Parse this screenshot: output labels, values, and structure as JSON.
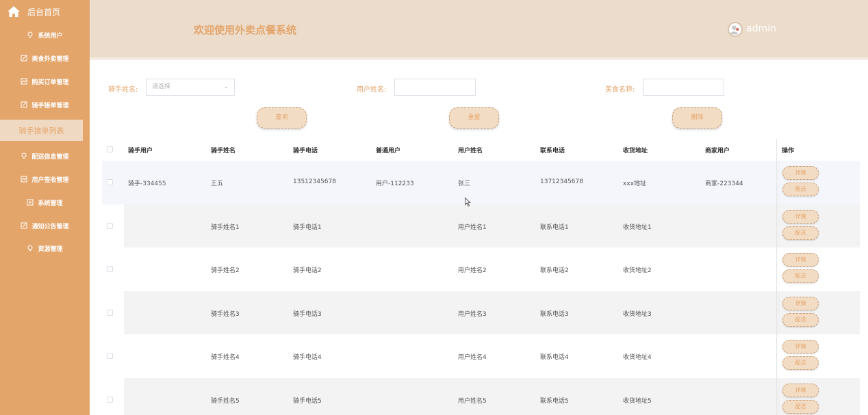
{
  "sidebar": {
    "home_label": "后台首页",
    "items": [
      {
        "label": "系统用户",
        "icon": "bulb-icon"
      },
      {
        "label": "美食外卖管理",
        "icon": "edit-icon"
      },
      {
        "label": "购买订单管理",
        "icon": "chart-icon"
      },
      {
        "label": "骑手接单管理",
        "icon": "edit-icon"
      },
      {
        "label": "骑手接单列表",
        "icon": "",
        "active": true
      },
      {
        "label": "配送信息管理",
        "icon": "bulb-icon"
      },
      {
        "label": "用户签收管理",
        "icon": "chart-icon"
      },
      {
        "label": "系统管理",
        "icon": "plus-box-icon"
      },
      {
        "label": "通知公告管理",
        "icon": "edit-icon"
      },
      {
        "label": "资源管理",
        "icon": "bulb-icon"
      }
    ]
  },
  "header": {
    "title": "欢迎使用外卖点餐系统",
    "username": "admin"
  },
  "search": {
    "rider_name_label": "骑手姓名:",
    "rider_name_placeholder": "请选择",
    "user_name_label": "用户姓名:",
    "food_name_label": "美食名称:",
    "query_button": "查询",
    "reset_button": "重置",
    "delete_button": "删除"
  },
  "table": {
    "headers": [
      "骑手用户",
      "骑手姓名",
      "骑手电话",
      "普通用户",
      "用户姓名",
      "联系电话",
      "收货地址",
      "商家用户",
      "操作"
    ],
    "rows": [
      [
        "骑手-334455",
        "王五",
        "13512345678",
        "用户-112233",
        "张三",
        "13712345678",
        "xxx地址",
        "商家-223344"
      ],
      [
        "",
        "骑手姓名1",
        "骑手电话1",
        "",
        "用户姓名1",
        "联系电话1",
        "收货地址1",
        ""
      ],
      [
        "",
        "骑手姓名2",
        "骑手电话2",
        "",
        "用户姓名2",
        "联系电话2",
        "收货地址2",
        ""
      ],
      [
        "",
        "骑手姓名3",
        "骑手电话3",
        "",
        "用户姓名3",
        "联系电话3",
        "收货地址3",
        ""
      ],
      [
        "",
        "骑手姓名4",
        "骑手电话4",
        "",
        "用户姓名4",
        "联系电话4",
        "收货地址4",
        ""
      ],
      [
        "",
        "骑手姓名5",
        "骑手电话5",
        "",
        "用户姓名5",
        "联系电话5",
        "收货地址5",
        ""
      ]
    ],
    "detail_button": "详情",
    "deliver_button": "配送"
  },
  "colors": {
    "accent": "#e4a56b",
    "header_bg": "#ecdccb",
    "button_bg": "#f3dcc4"
  }
}
